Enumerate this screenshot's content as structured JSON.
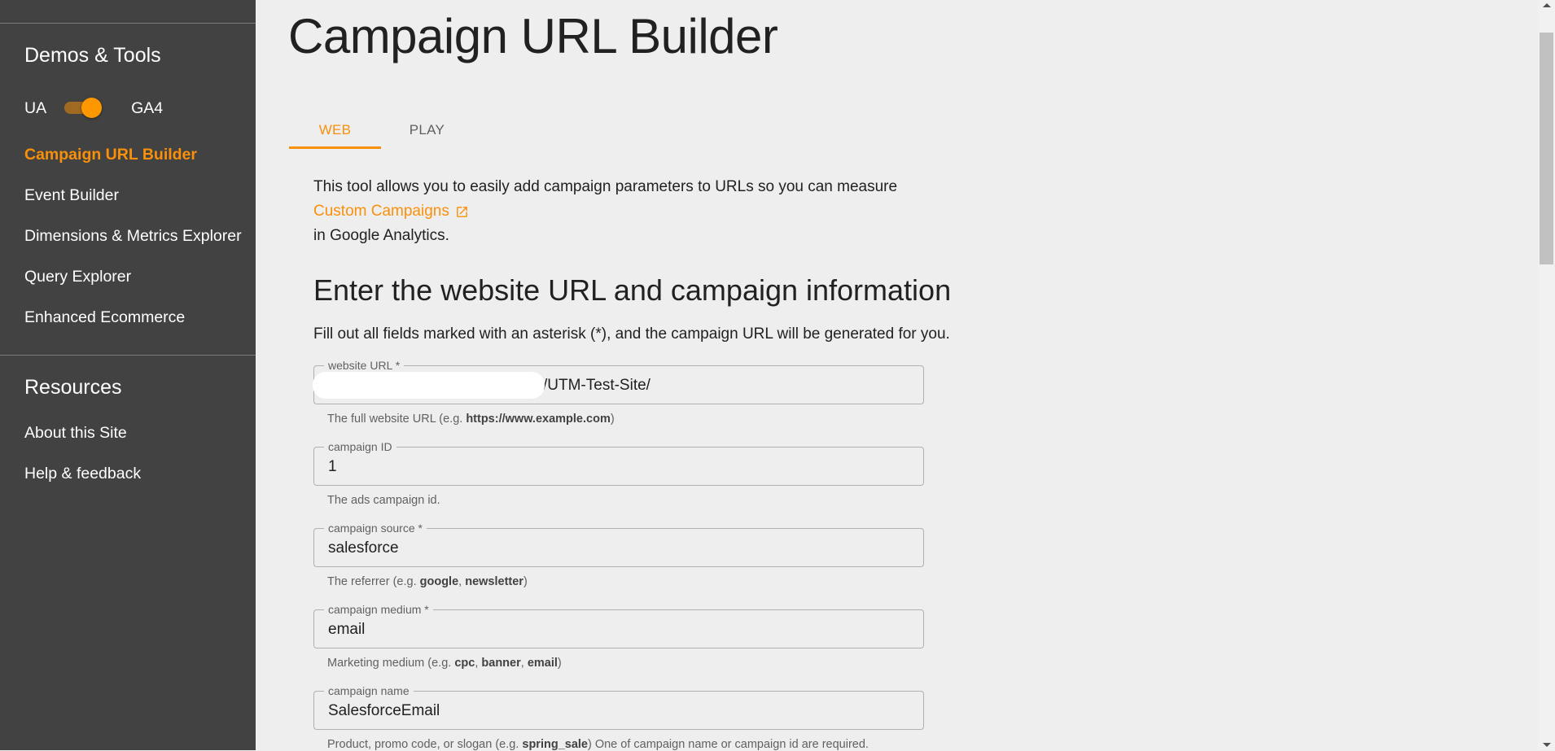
{
  "sidebar": {
    "section1_heading": "Demos & Tools",
    "toggle": {
      "left_label": "UA",
      "right_label": "GA4",
      "state": "GA4"
    },
    "items": [
      {
        "label": "Campaign URL Builder",
        "active": true
      },
      {
        "label": "Event Builder"
      },
      {
        "label": "Dimensions & Metrics Explorer"
      },
      {
        "label": "Query Explorer"
      },
      {
        "label": "Enhanced Ecommerce"
      }
    ],
    "section2_heading": "Resources",
    "resources": [
      {
        "label": "About this Site"
      },
      {
        "label": "Help & feedback"
      }
    ]
  },
  "main": {
    "title": "Campaign URL Builder",
    "tabs": [
      {
        "label": "WEB",
        "active": true
      },
      {
        "label": "PLAY"
      }
    ],
    "intro": {
      "line1": "This tool allows you to easily add campaign parameters to URLs so you can measure",
      "link": "Custom Campaigns",
      "line3": "in Google Analytics."
    },
    "section_heading": "Enter the website URL and campaign information",
    "section_sub": "Fill out all fields marked with an asterisk (*), and the campaign URL will be generated for you.",
    "fields": [
      {
        "label": "website URL *",
        "value": "/UTM-Test-Site/",
        "helper_prefix": "The full website URL (e.g. ",
        "helper_bold": "https://www.example.com",
        "helper_suffix": ")"
      },
      {
        "label": "campaign ID",
        "value": "1",
        "helper_prefix": "The ads campaign id."
      },
      {
        "label": "campaign source *",
        "value": "salesforce",
        "helper_prefix": "The referrer (e.g. ",
        "helper_bold": "google",
        "helper_mid": ", ",
        "helper_bold2": "newsletter",
        "helper_suffix": ")"
      },
      {
        "label": "campaign medium *",
        "value": "email",
        "helper_prefix": "Marketing medium (e.g. ",
        "helper_bold": "cpc",
        "helper_mid": ", ",
        "helper_bold2": "banner",
        "helper_mid2": ", ",
        "helper_bold3": "email",
        "helper_suffix": ")"
      },
      {
        "label": "campaign name",
        "value": "SalesforceEmail",
        "helper_prefix": "Product, promo code, or slogan (e.g. ",
        "helper_bold": "spring_sale",
        "helper_suffix": ") One of campaign name or campaign id are required."
      }
    ]
  },
  "colors": {
    "accent": "#f9900b",
    "sidebar_bg": "#424242",
    "page_bg": "#eeeeee"
  }
}
